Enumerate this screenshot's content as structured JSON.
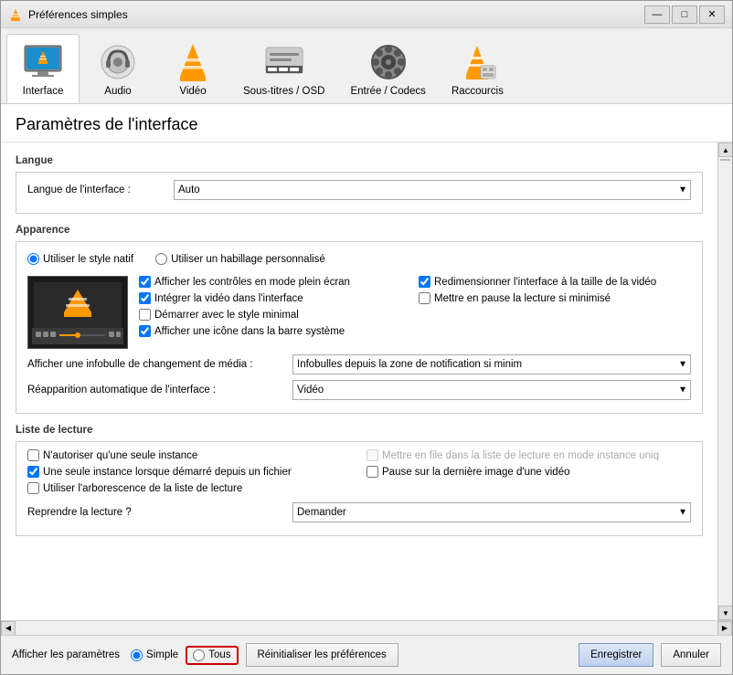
{
  "window": {
    "title": "Préférences simples",
    "title_icon": "🎥"
  },
  "title_bar_controls": {
    "minimize": "—",
    "maximize": "□",
    "close": "✕"
  },
  "nav": {
    "items": [
      {
        "id": "interface",
        "label": "Interface",
        "active": true
      },
      {
        "id": "audio",
        "label": "Audio",
        "active": false
      },
      {
        "id": "video",
        "label": "Vidéo",
        "active": false
      },
      {
        "id": "subtitles",
        "label": "Sous-titres / OSD",
        "active": false
      },
      {
        "id": "input",
        "label": "Entrée / Codecs",
        "active": false
      },
      {
        "id": "shortcuts",
        "label": "Raccourcis",
        "active": false
      }
    ]
  },
  "page": {
    "title": "Paramètres de l'interface"
  },
  "sections": {
    "langue": {
      "title": "Langue",
      "language_label": "Langue de l'interface :",
      "language_value": "Auto"
    },
    "apparence": {
      "title": "Apparence",
      "radio_native": "Utiliser le style natif",
      "radio_custom": "Utiliser un habillage personnalisé",
      "checkboxes": [
        {
          "id": "cb1",
          "label": "Afficher les contrôles en mode plein écran",
          "checked": true
        },
        {
          "id": "cb2",
          "label": "Intégrer la vidéo dans l'interface",
          "checked": true
        },
        {
          "id": "cb3",
          "label": "Démarrer avec le style minimal",
          "checked": false
        },
        {
          "id": "cb4",
          "label": "Afficher une icône dans la barre système",
          "checked": true
        }
      ],
      "checkboxes_right": [
        {
          "id": "cb5",
          "label": "Redimensionner l'interface à la taille de la vidéo",
          "checked": true
        },
        {
          "id": "cb6",
          "label": "Mettre en pause la lecture si minimisé",
          "checked": false
        }
      ],
      "infobulle_label": "Afficher une infobulle de changement de média :",
      "infobulle_value": "Infobulles depuis la zone de notification si minim",
      "reapparition_label": "Réapparition automatique de l'interface :",
      "reapparition_value": "Vidéo"
    },
    "liste_lecture": {
      "title": "Liste de lecture",
      "checkboxes_left": [
        {
          "id": "ll1",
          "label": "N'autoriser qu'une seule instance",
          "checked": false
        },
        {
          "id": "ll2",
          "label": "Une seule instance lorsque démarré depuis un fichier",
          "checked": true
        },
        {
          "id": "ll3",
          "label": "Utiliser l'arborescence de la liste de lecture",
          "checked": false
        }
      ],
      "checkboxes_right": [
        {
          "id": "ll4",
          "label": "Mettre en file dans la liste de lecture en mode instance uniq",
          "checked": false,
          "disabled": true
        },
        {
          "id": "ll5",
          "label": "Pause sur la dernière image d'une vidéo",
          "checked": false
        }
      ],
      "reprendre_label": "Reprendre la lecture ?",
      "reprendre_value": "Demander"
    }
  },
  "bottom": {
    "afficher_label": "Afficher les paramètres",
    "simple_label": "Simple",
    "tous_label": "Tous",
    "reinitialiser_label": "Réinitialiser les préférences",
    "enregistrer_label": "Enregistrer",
    "annuler_label": "Annuler"
  }
}
